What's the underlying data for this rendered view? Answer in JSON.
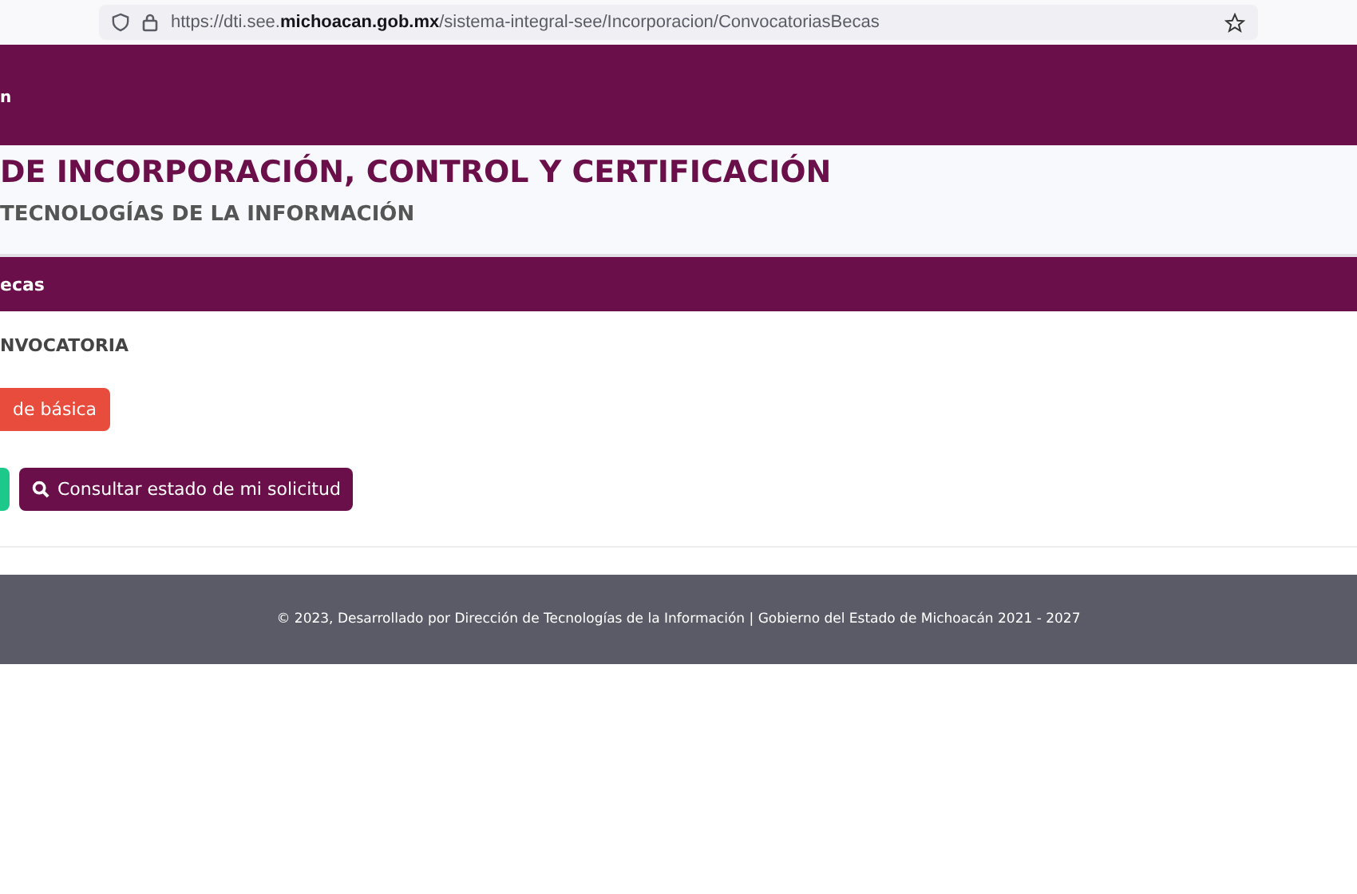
{
  "browser": {
    "url": "https://dti.see.**michoacan.gob.mx**/sistema-integral-see/Incorporacion/ConvocatoriasBecas"
  },
  "header": {
    "logo_text": "n"
  },
  "titles": {
    "title": "DE INCORPORACIÓN, CONTROL Y CERTIFICACIÓN",
    "subtitle": "TECNOLOGÍAS DE LA INFORMACIÓN"
  },
  "section_bar": {
    "label": "ecas"
  },
  "content": {
    "heading": "NVOCATORIA",
    "buttons": [
      {
        "kind": "danger",
        "label": "de básica"
      }
    ],
    "actions": [
      {
        "kind": "success"
      },
      {
        "kind": "primary",
        "label": "Consultar estado de mi solicitud"
      }
    ]
  },
  "footer": {
    "text": "© 2023, Desarrollado por Dirección de Tecnologías de la Información | Gobierno del Estado de Michoacán 2021 - 2027"
  }
}
